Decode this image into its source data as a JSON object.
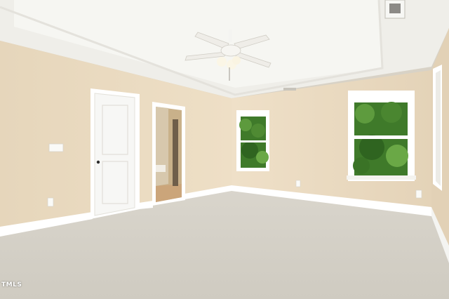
{
  "photo": {
    "watermark": "TMLS",
    "colors": {
      "wall": "#ecdcc3",
      "wall_shadow": "#e2d2b8",
      "ceiling": "#efeee9",
      "tray": "#f7f7f4",
      "trim": "#ffffff",
      "carpet": "#d5d1c8",
      "foliage": "#3f7a2a"
    }
  }
}
